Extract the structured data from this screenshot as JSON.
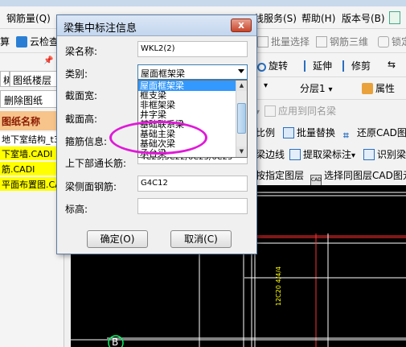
{
  "menubar": {
    "items": [
      "钢筋量(Q)",
      "线服务(S)",
      "帮助(H)",
      "版本号(B)"
    ]
  },
  "toolbar": {
    "calc_label": "算",
    "cloud_check_label": "云检查",
    "batch_select_label": "批量选择",
    "rebar_3d_label": "钢筋三维",
    "lock_label": "锁定"
  },
  "toolbar2": {
    "rotate_label": "旋转",
    "extend_label": "延伸",
    "trim_label": "修剪"
  },
  "toolbar3": {
    "layer_value": "分层1",
    "property_label": "属性"
  },
  "toolbar4": {
    "apply_same_name_label": "应用到同名梁"
  },
  "toolbar5": {
    "ratio_label": "比例",
    "batch_replace_label": "批量替换",
    "restore_cad_label": "还原CAD图"
  },
  "toolbar6": {
    "edge_line_label": "梁边线",
    "extract_label": "提取梁标注",
    "identify_label": "识别梁"
  },
  "toolbar7": {
    "specify_layer_label": "按指定图层",
    "select_same_layer_label": "选择同图层CAD图元"
  },
  "leftpanel": {
    "tabs": [
      "树",
      "图纸楼层"
    ],
    "delete_button": "删除图纸",
    "header": "图纸名称",
    "rows": [
      "地下室结构_t3",
      "下室墙.CADI",
      "筋.CADI",
      "平面布置图.CA"
    ]
  },
  "dialog": {
    "title": "梁集中标注信息",
    "close_glyph": "x",
    "fields": {
      "beam_name_label": "梁名称:",
      "beam_name_value": "WKL2(2)",
      "category_label": "类别:",
      "category_value": "屋面框架梁",
      "section_width_label": "截面宽:",
      "section_height_label": "截面高:",
      "stirrup_label": "箍筋信息:",
      "through_bar_label": "上下部通长筋:",
      "through_bar_value": "4C25;5C22/6C25/6C25",
      "side_bar_label": "梁侧面钢筋:",
      "side_bar_value": "G4C12",
      "elevation_label": "标高:",
      "elevation_value": ""
    },
    "dropdown_options": [
      "屋面框架梁",
      "框支梁",
      "非框架梁",
      "井字梁",
      "基础联系梁",
      "基础主梁",
      "基础次梁",
      "承台梁"
    ],
    "selected_option": "屋面框架梁",
    "ok_label": "确定(O)",
    "cancel_label": "取消(C)"
  },
  "canvas": {
    "axis_label": "B",
    "vertical_text": "12C20 4/4/4"
  },
  "colors": {
    "canvas_bg": "#000000",
    "highlight_ellipse": "#e019d8",
    "selected_item": "#3399ff",
    "left_header": "#f7c48b",
    "file_row": "#ffff00"
  }
}
